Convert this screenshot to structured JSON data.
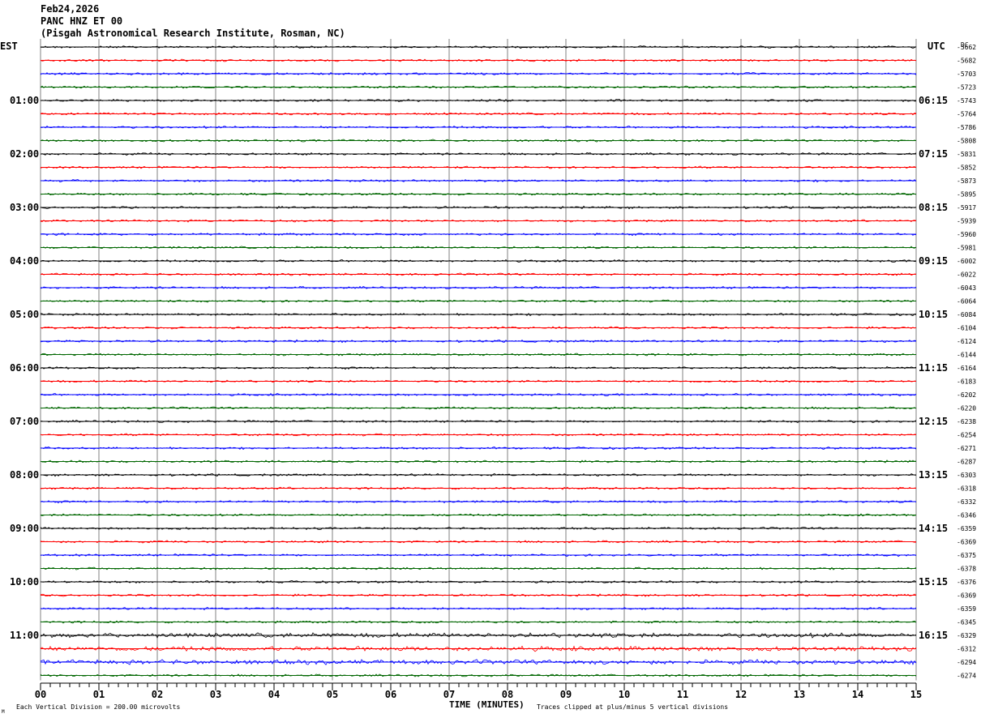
{
  "header": {
    "date": "Feb24,2026",
    "station": "PANC HNZ ET 00",
    "institution": "(Pisgah Astronomical Research Institute, Rosman, NC)"
  },
  "left_zone_label": "EST",
  "right_zone_label": "UTC",
  "dc_label": "DC",
  "footer": {
    "scale_note": "Each Vertical Division =  200.00 microvolts",
    "clip_note": "Traces clipped at plus/minus 5 vertical divisions",
    "corner_mark": "M"
  },
  "colors": {
    "cycle": [
      "#000000",
      "#ff0000",
      "#0000ff",
      "#006600"
    ],
    "grid": "#808080"
  },
  "chart_data": {
    "type": "line",
    "title": "PANC HNZ ET 00",
    "xlabel": "TIME (MINUTES)",
    "ylabel": "",
    "xlim": [
      0,
      15
    ],
    "x_ticks": [
      "00",
      "01",
      "02",
      "03",
      "04",
      "05",
      "06",
      "07",
      "08",
      "09",
      "10",
      "11",
      "12",
      "13",
      "14",
      "15"
    ],
    "rows_per_hour": 4,
    "row_count": 48,
    "left_time_labels": [
      "01:00",
      "02:00",
      "03:00",
      "04:00",
      "05:00",
      "06:00",
      "07:00",
      "08:00",
      "09:00",
      "10:00",
      "11:00"
    ],
    "right_time_labels": [
      "06:15",
      "07:15",
      "08:15",
      "09:15",
      "10:15",
      "11:15",
      "12:15",
      "13:15",
      "14:15",
      "15:15",
      "16:15"
    ],
    "dc_offsets": [
      -5662,
      -5682,
      -5703,
      -5723,
      -5743,
      -5764,
      -5786,
      -5808,
      -5831,
      -5852,
      -5873,
      -5895,
      -5917,
      -5939,
      -5960,
      -5981,
      -6002,
      -6022,
      -6043,
      -6064,
      -6084,
      -6104,
      -6124,
      -6144,
      -6164,
      -6183,
      -6202,
      -6220,
      -6238,
      -6254,
      -6271,
      -6287,
      -6303,
      -6318,
      -6332,
      -6346,
      -6359,
      -6369,
      -6375,
      -6378,
      -6376,
      -6369,
      -6359,
      -6345,
      -6329,
      -6312,
      -6294,
      -6274
    ],
    "series": [
      {
        "name": "",
        "noise": "seismic background"
      }
    ]
  }
}
